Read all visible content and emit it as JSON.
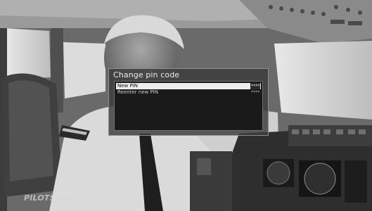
{
  "dialog": {
    "title": "Change pin code",
    "fields": [
      {
        "label": "New PIN",
        "value": "****",
        "selected": true
      },
      {
        "label": "Reenter new PIN",
        "value": "****",
        "selected": false
      }
    ]
  },
  "watermark": {
    "text": "PILOTSEYE.tv"
  }
}
